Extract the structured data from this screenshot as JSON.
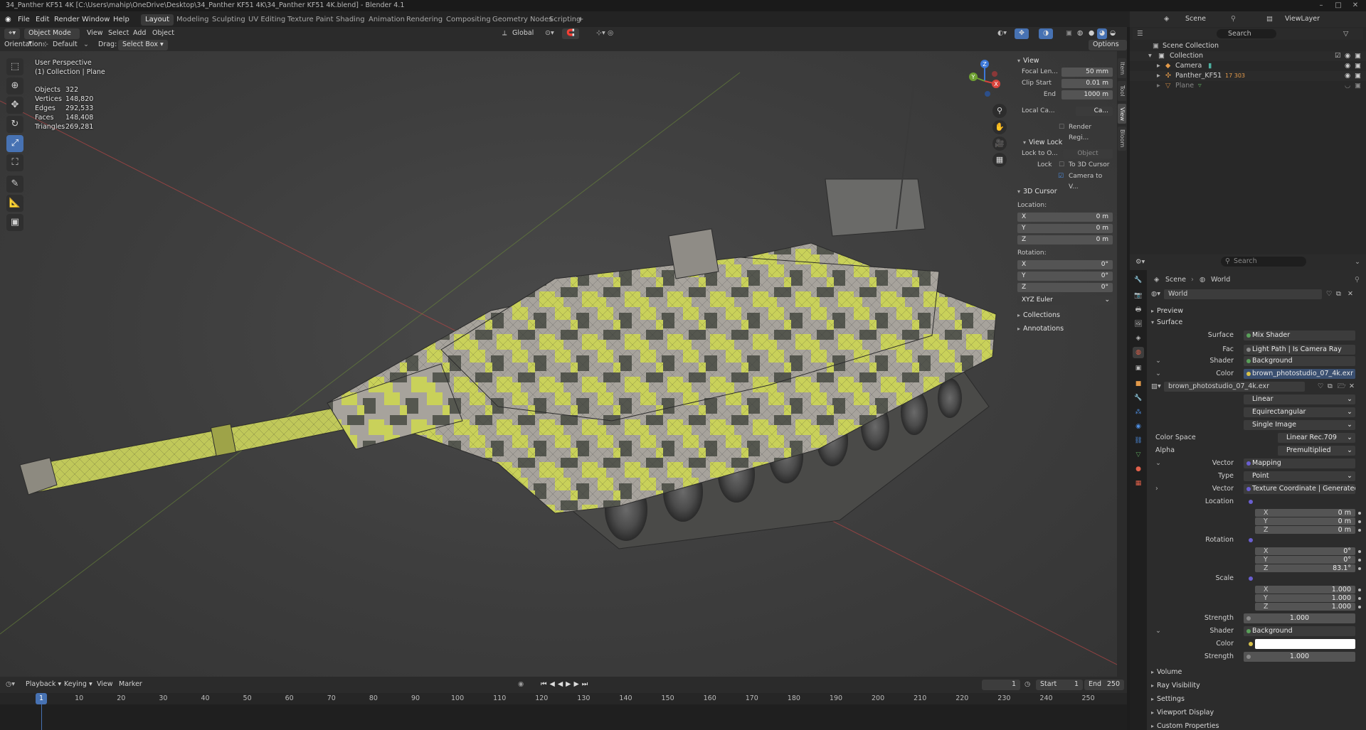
{
  "window": {
    "title": "34_Panther KF51 4K [C:\\Users\\mahip\\OneDrive\\Desktop\\34_Panther KF51 4K\\34_Panther KF51 4K.blend] - Blender 4.1",
    "minimize": "–",
    "maximize": "□",
    "close": "✕"
  },
  "menu": {
    "file": "File",
    "edit": "Edit",
    "render": "Render",
    "window": "Window",
    "help": "Help"
  },
  "workspaces": [
    "Layout",
    "Modeling",
    "Sculpting",
    "UV Editing",
    "Texture Paint",
    "Shading",
    "Animation",
    "Rendering",
    "Compositing",
    "Geometry Nodes",
    "Scripting"
  ],
  "add_workspace": "+",
  "header": {
    "mode": "Object Mode",
    "view": "View",
    "select": "Select",
    "add": "Add",
    "object": "Object",
    "transform": "Global",
    "orientation_label": "Orientation:",
    "orientation_value": "Default",
    "drag_label": "Drag:",
    "drag_value": "Select Box",
    "options": "Options"
  },
  "viewport": {
    "perspective": "User Perspective",
    "collection": "(1) Collection | Plane",
    "stats": [
      {
        "label": "Objects",
        "value": "322"
      },
      {
        "label": "Vertices",
        "value": "148,820"
      },
      {
        "label": "Edges",
        "value": "292,533"
      },
      {
        "label": "Faces",
        "value": "148,408"
      },
      {
        "label": "Triangles",
        "value": "269,281"
      }
    ],
    "gizmo": {
      "z": "Z",
      "x": "X",
      "y": "Y"
    }
  },
  "npanel": {
    "tabs": [
      "Item",
      "Tool",
      "View",
      "Bloom"
    ],
    "view_header": "View",
    "focal_label": "Focal Len...",
    "focal_value": "50 mm",
    "clip_start_label": "Clip Start",
    "clip_start_value": "0.01 m",
    "end_label": "End",
    "end_value": "1000 m",
    "local_camera_label": "Local Ca...",
    "local_camera_value": "Ca...",
    "render_region": "Render Regi...",
    "view_lock_header": "View Lock",
    "lock_to_object_label": "Lock to O...",
    "lock_to_object_placeholder": "Object",
    "lock_label": "Lock",
    "to_3d_cursor": "To 3D Cursor",
    "camera_to_view": "Camera to V...",
    "cursor_header": "3D Cursor",
    "location_label": "Location:",
    "rotation_label": "Rotation:",
    "loc": [
      {
        "axis": "X",
        "value": "0 m"
      },
      {
        "axis": "Y",
        "value": "0 m"
      },
      {
        "axis": "Z",
        "value": "0 m"
      }
    ],
    "rot": [
      {
        "axis": "X",
        "value": "0°"
      },
      {
        "axis": "Y",
        "value": "0°"
      },
      {
        "axis": "Z",
        "value": "0°"
      }
    ],
    "rotation_mode": "XYZ Euler",
    "collections": "Collections",
    "annotations": "Annotations"
  },
  "timeline": {
    "playback": "Playback",
    "keying": "Keying",
    "view": "View",
    "marker": "Marker",
    "current_frame": "1",
    "start_label": "Start",
    "start_value": "1",
    "end_label": "End",
    "end_value": "250",
    "ticks": [
      "1",
      "10",
      "20",
      "30",
      "40",
      "50",
      "60",
      "70",
      "80",
      "90",
      "100",
      "110",
      "120",
      "130",
      "140",
      "150",
      "160",
      "170",
      "180",
      "190",
      "200",
      "210",
      "220",
      "230",
      "240",
      "250"
    ]
  },
  "outliner": {
    "scene": "Scene",
    "view_layer": "ViewLayer",
    "search_placeholder": "Search",
    "items": [
      {
        "name": "Scene Collection"
      },
      {
        "name": "Collection"
      },
      {
        "name": "Camera"
      },
      {
        "name": "Panther_KF51",
        "badge": "17 303"
      },
      {
        "name": "Plane"
      }
    ]
  },
  "properties": {
    "search_placeholder": "Search",
    "breadcrumb_scene": "Scene",
    "breadcrumb_world": "World",
    "world_name": "World",
    "preview": "Preview",
    "surface_section": "Surface",
    "rows": {
      "surface_label": "Surface",
      "surface_value": "Mix Shader",
      "fac_label": "Fac",
      "fac_value": "Light Path | Is Camera Ray",
      "shader1_label": "Shader",
      "shader1_value": "Background",
      "color1_label": "Color",
      "color1_value": "brown_photostudio_07_4k.exr",
      "image_name": "brown_photostudio_07_4k.exr",
      "interp": "Linear",
      "projection": "Equirectangular",
      "source": "Single Image",
      "colorspace_label": "Color Space",
      "colorspace_value": "Linear Rec.709",
      "alpha_label": "Alpha",
      "alpha_value": "Premultiplied",
      "vector1_label": "Vector",
      "vector1_value": "Mapping",
      "type_label": "Type",
      "type_value": "Point",
      "vector2_label": "Vector",
      "vector2_value": "Texture Coordinate | Generated",
      "location_label": "Location",
      "rotation_label": "Rotation",
      "scale_label": "Scale",
      "strength1_label": "Strength",
      "strength1_value": "1.000",
      "shader2_label": "Shader",
      "shader2_value": "Background",
      "color2_label": "Color",
      "strength2_label": "Strength",
      "strength2_value": "1.000"
    },
    "location": [
      {
        "axis": "X",
        "value": "0 m"
      },
      {
        "axis": "Y",
        "value": "0 m"
      },
      {
        "axis": "Z",
        "value": "0 m"
      }
    ],
    "rotation": [
      {
        "axis": "X",
        "value": "0°"
      },
      {
        "axis": "Y",
        "value": "0°"
      },
      {
        "axis": "Z",
        "value": "83.1°"
      }
    ],
    "scale": [
      {
        "axis": "X",
        "value": "1.000"
      },
      {
        "axis": "Y",
        "value": "1.000"
      },
      {
        "axis": "Z",
        "value": "1.000"
      }
    ],
    "collapsed": [
      "Volume",
      "Ray Visibility",
      "Settings",
      "Viewport Display",
      "Custom Properties"
    ]
  },
  "colors": {
    "accent": "#4772b3",
    "camo_light": "#c9d15a",
    "camo_grey": "#a7a39c",
    "camo_dark": "#55574f"
  }
}
